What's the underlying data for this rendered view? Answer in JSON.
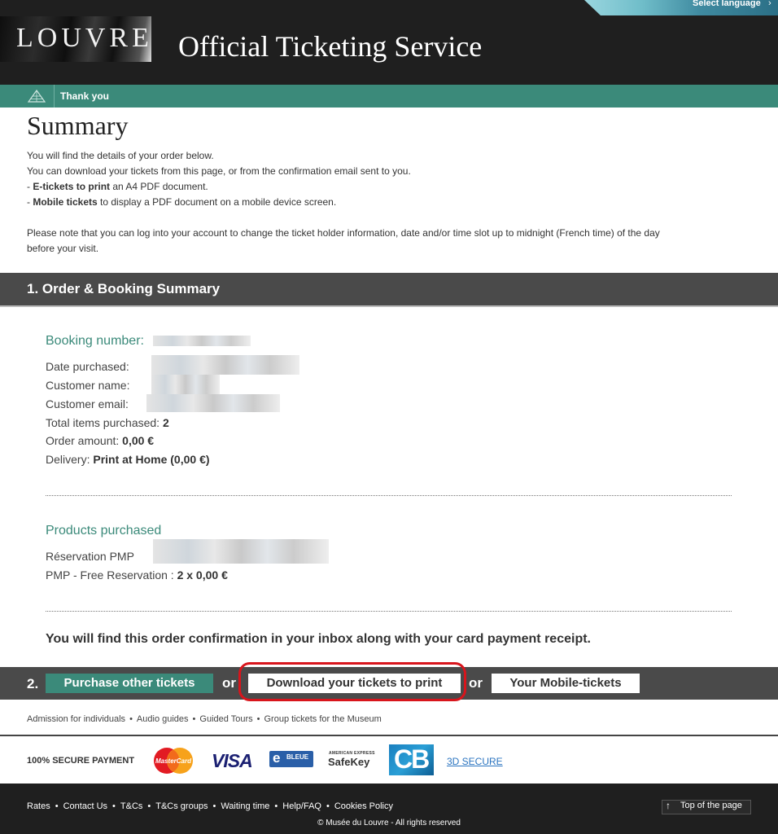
{
  "header": {
    "logo_text": "LOUVRE",
    "title": "Official Ticketing Service",
    "language_link": "Select language"
  },
  "breadcrumb": {
    "label": "Thank you"
  },
  "summary": {
    "title": "Summary",
    "intro": [
      "You will find the details of your order below.",
      "You can download your tickets from this page, or from the confirmation email sent to you."
    ],
    "etickets_bold": "E-tickets to print",
    "etickets_rest": " an A4 PDF document.",
    "mobile_bold": "Mobile tickets",
    "mobile_rest": " to display a PDF document on a mobile device screen.",
    "bullet_prefix": "- ",
    "note_line1": "Please note that you can log into your account to change the ticket holder information, date and/or time slot up to midnight (French time) of the day",
    "note_line2": "before your visit."
  },
  "section1": {
    "title": "1. Order & Booking Summary",
    "booking_number_label": "Booking number:",
    "date_label": "Date purchased:",
    "customer_name_label": "Customer name:",
    "customer_email_label": "Customer email:",
    "total_items_label": "Total items purchased:",
    "total_items_value": "2",
    "order_amount_label": "Order amount:",
    "order_amount_value": "0,00 €",
    "delivery_label": "Delivery:",
    "delivery_value": "Print at Home (0,00 €)",
    "products_label": "Products purchased",
    "reservation_label": "Réservation PMP",
    "free_reservation_label": "PMP - Free Reservation :",
    "free_reservation_value": "2 x 0,00 €",
    "inbox_note": "You will find this order confirmation in your inbox along with your card payment receipt."
  },
  "section2": {
    "number": "2.",
    "purchase_button": "Purchase other tickets",
    "or": "or",
    "download_button": "Download your tickets to print",
    "mobile_button": "Your Mobile-tickets"
  },
  "links": [
    "Admission for individuals",
    "Audio guides",
    "Guided Tours",
    "Group tickets for the Museum"
  ],
  "link_separator": "•",
  "payment": {
    "secure_label": "100% SECURE PAYMENT",
    "mastercard": "MasterCard",
    "visa": "VISA",
    "ebleue_e": "e",
    "ebleue": "BLEUE",
    "safekey_top": "AMERICAN EXPRESS",
    "safekey": "SafeKey",
    "cb": "CB",
    "secure3d": "3D SECURE"
  },
  "footer": {
    "links": [
      "Rates",
      "Contact Us",
      "T&Cs",
      "T&Cs groups",
      "Waiting time",
      "Help/FAQ",
      "Cookies Policy"
    ],
    "top_arrow": "↑",
    "top_link": "Top of the page",
    "copyright": "© Musée du Louvre - All rights reserved"
  },
  "colors": {
    "brand_green": "#3b8a7a",
    "header_dark": "#1f1f1f",
    "section_gray": "#4a4a4a",
    "highlight_red": "#d8151c"
  }
}
